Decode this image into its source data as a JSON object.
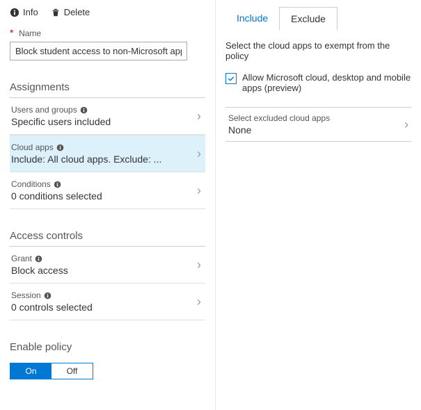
{
  "toolbar": {
    "info": "Info",
    "delete": "Delete"
  },
  "name": {
    "label": "Name",
    "value": "Block student access to non-Microsoft apps"
  },
  "sections": {
    "assignments": "Assignments",
    "access_controls": "Access controls",
    "enable_policy": "Enable policy"
  },
  "assignments": {
    "users": {
      "title": "Users and groups",
      "value": "Specific users included"
    },
    "cloud": {
      "title": "Cloud apps",
      "value": "Include: All cloud apps. Exclude: ..."
    },
    "conditions": {
      "title": "Conditions",
      "value": "0 conditions selected"
    }
  },
  "access": {
    "grant": {
      "title": "Grant",
      "value": "Block access"
    },
    "session": {
      "title": "Session",
      "value": "0 controls selected"
    }
  },
  "toggle": {
    "on": "On",
    "off": "Off"
  },
  "right": {
    "tabs": {
      "include": "Include",
      "exclude": "Exclude"
    },
    "instruction": "Select the cloud apps to exempt from the policy",
    "allow_label": "Allow Microsoft cloud, desktop and mobile apps (preview)",
    "excluded": {
      "title": "Select excluded cloud apps",
      "value": "None"
    }
  }
}
